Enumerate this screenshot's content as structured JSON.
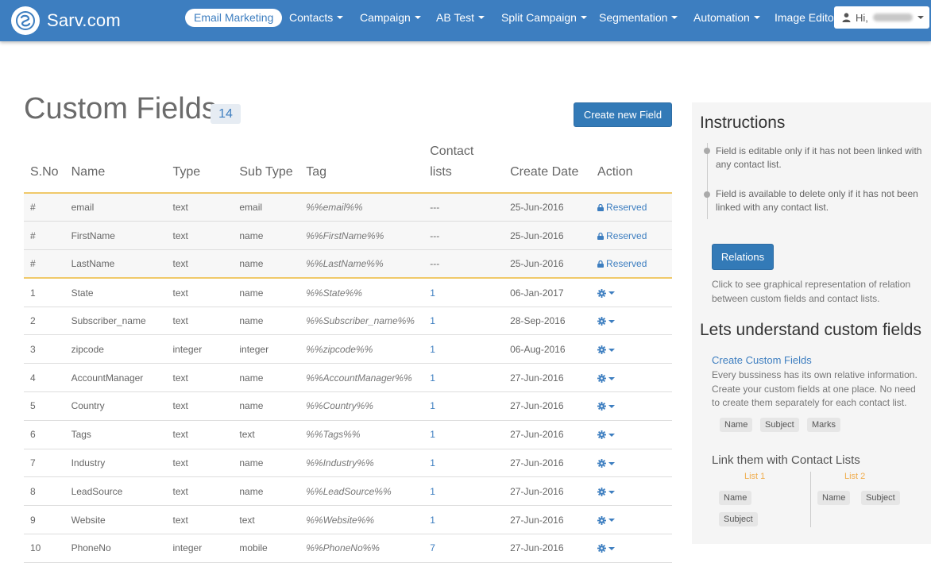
{
  "brand": {
    "name": "Sarv.com"
  },
  "nav": {
    "items": [
      {
        "label": "Email Marketing",
        "active": true,
        "dropdown": false
      },
      {
        "label": "Contacts",
        "dropdown": true
      },
      {
        "label": "Campaign",
        "dropdown": true
      },
      {
        "label": "AB Test",
        "dropdown": true
      },
      {
        "label": "Split Campaign",
        "dropdown": true
      },
      {
        "label": "Segmentation",
        "dropdown": true
      },
      {
        "label": "Automation",
        "dropdown": true
      },
      {
        "label": "Image Editor",
        "dropdown": false
      }
    ],
    "user_greeting": "Hi,"
  },
  "page": {
    "title": "Custom Fields",
    "count": "14",
    "create_button": "Create new Field"
  },
  "table": {
    "headers": {
      "sno": "S.No",
      "name": "Name",
      "type": "Type",
      "subtype": "Sub Type",
      "tag": "Tag",
      "contact_lists_line1": "Contact",
      "contact_lists_line2": "lists",
      "create_date": "Create Date",
      "action": "Action"
    },
    "reserved_label": "Reserved",
    "rows": [
      {
        "sno": "#",
        "name": "email",
        "type": "text",
        "subtype": "email",
        "tag": "%%email%%",
        "lists": "---",
        "date": "25-Jun-2016",
        "reserved": true
      },
      {
        "sno": "#",
        "name": "FirstName",
        "type": "text",
        "subtype": "name",
        "tag": "%%FirstName%%",
        "lists": "---",
        "date": "25-Jun-2016",
        "reserved": true
      },
      {
        "sno": "#",
        "name": "LastName",
        "type": "text",
        "subtype": "name",
        "tag": "%%LastName%%",
        "lists": "---",
        "date": "25-Jun-2016",
        "reserved": true
      },
      {
        "sno": "1",
        "name": "State",
        "type": "text",
        "subtype": "name",
        "tag": "%%State%%",
        "lists": "1",
        "date": "06-Jan-2017",
        "reserved": false
      },
      {
        "sno": "2",
        "name": "Subscriber_name",
        "type": "text",
        "subtype": "name",
        "tag": "%%Subscriber_name%%",
        "lists": "1",
        "date": "28-Sep-2016",
        "reserved": false
      },
      {
        "sno": "3",
        "name": "zipcode",
        "type": "integer",
        "subtype": "integer",
        "tag": "%%zipcode%%",
        "lists": "1",
        "date": "06-Aug-2016",
        "reserved": false
      },
      {
        "sno": "4",
        "name": "AccountManager",
        "type": "text",
        "subtype": "name",
        "tag": "%%AccountManager%%",
        "lists": "1",
        "date": "27-Jun-2016",
        "reserved": false
      },
      {
        "sno": "5",
        "name": "Country",
        "type": "text",
        "subtype": "name",
        "tag": "%%Country%%",
        "lists": "1",
        "date": "27-Jun-2016",
        "reserved": false
      },
      {
        "sno": "6",
        "name": "Tags",
        "type": "text",
        "subtype": "text",
        "tag": "%%Tags%%",
        "lists": "1",
        "date": "27-Jun-2016",
        "reserved": false
      },
      {
        "sno": "7",
        "name": "Industry",
        "type": "text",
        "subtype": "name",
        "tag": "%%Industry%%",
        "lists": "1",
        "date": "27-Jun-2016",
        "reserved": false
      },
      {
        "sno": "8",
        "name": "LeadSource",
        "type": "text",
        "subtype": "name",
        "tag": "%%LeadSource%%",
        "lists": "1",
        "date": "27-Jun-2016",
        "reserved": false
      },
      {
        "sno": "9",
        "name": "Website",
        "type": "text",
        "subtype": "text",
        "tag": "%%Website%%",
        "lists": "1",
        "date": "27-Jun-2016",
        "reserved": false
      },
      {
        "sno": "10",
        "name": "PhoneNo",
        "type": "integer",
        "subtype": "mobile",
        "tag": "%%PhoneNo%%",
        "lists": "7",
        "date": "27-Jun-2016",
        "reserved": false
      }
    ]
  },
  "sidebar": {
    "instructions_title": "Instructions",
    "instructions": [
      "Field is editable only if it has not been linked with any contact list.",
      "Field is available to delete only if it has not been linked with any contact list."
    ],
    "relations_button": "Relations",
    "relations_desc": "Click to see graphical representation of relation between custom fields and contact lists.",
    "understand_title": "Lets understand custom fields",
    "create_link": "Create Custom Fields",
    "create_desc": "Every bussiness has its own relative information. Create your custom fields at one place. No need to create them separately for each contact list.",
    "chips": [
      "Name",
      "Subject",
      "Marks"
    ],
    "link_title": "Link them with Contact Lists",
    "list1_label": "List 1",
    "list2_label": "List 2",
    "list1_chips": [
      "Name",
      "Subject"
    ],
    "list2_chips": [
      "Name",
      "Subject"
    ]
  },
  "colors": {
    "navbar": "#3d7ec0",
    "link": "#3d7ec0",
    "primary_button": "#337ab7",
    "highlight_border": "#f0c96a",
    "list_label": "#f0ad4e"
  },
  "icons": {
    "brand": "sarv-logo-icon",
    "user": "user-icon",
    "lock": "lock-icon",
    "gear": "gear-icon"
  }
}
